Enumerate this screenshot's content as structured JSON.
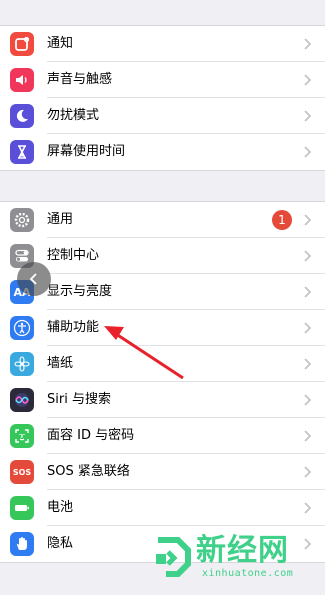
{
  "group1": [
    {
      "label": "通知",
      "icon": "notifications-icon",
      "color": "#f04b3e"
    },
    {
      "label": "声音与触感",
      "icon": "sound-icon",
      "color": "#f0365a"
    },
    {
      "label": "勿扰模式",
      "icon": "moon-icon",
      "color": "#5a4fd9"
    },
    {
      "label": "屏幕使用时间",
      "icon": "hourglass-icon",
      "color": "#5a4fd9"
    }
  ],
  "group2": [
    {
      "label": "通用",
      "icon": "gear-icon",
      "color": "#8e8e93",
      "badge": "1"
    },
    {
      "label": "控制中心",
      "icon": "toggle-icon",
      "color": "#8e8e93"
    },
    {
      "label": "显示与亮度",
      "icon": "text-size-icon",
      "color": "#2f7bf2",
      "icon_text": "AA"
    },
    {
      "label": "辅助功能",
      "icon": "accessibility-icon",
      "color": "#2f7bf2"
    },
    {
      "label": "墙纸",
      "icon": "flower-icon",
      "color": "#39a9e0"
    },
    {
      "label": "Siri 与搜索",
      "icon": "siri-icon",
      "color": "#2a2a3a"
    },
    {
      "label": "面容 ID 与密码",
      "icon": "face-id-icon",
      "color": "#35c759"
    },
    {
      "label": "SOS 紧急联络",
      "icon": "sos-icon",
      "color": "#e5493a",
      "icon_text": "SOS"
    },
    {
      "label": "电池",
      "icon": "battery-icon",
      "color": "#35c759"
    },
    {
      "label": "隐私",
      "icon": "hand-icon",
      "color": "#2f7bf2"
    }
  ],
  "watermark": {
    "brand": "新经网",
    "url": "xinhuatone.com",
    "color": "#3fd189"
  }
}
